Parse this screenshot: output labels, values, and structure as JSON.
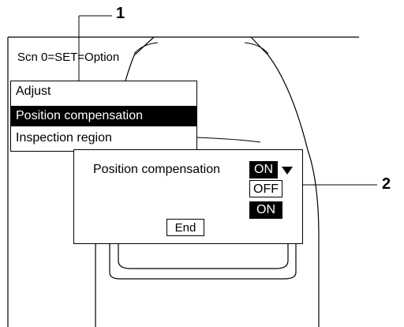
{
  "screen": {
    "title": "Scn 0=SET=Option"
  },
  "menu": {
    "items": [
      {
        "label": "Adjust",
        "selected": false
      },
      {
        "label": "Position compensation",
        "selected": true
      },
      {
        "label": "Inspection region",
        "selected": false
      }
    ]
  },
  "dialog": {
    "label": "Position compensation",
    "current_value": "ON",
    "options": [
      "OFF",
      "ON"
    ],
    "end_label": "End"
  },
  "callouts": {
    "one": "1",
    "two": "2"
  }
}
